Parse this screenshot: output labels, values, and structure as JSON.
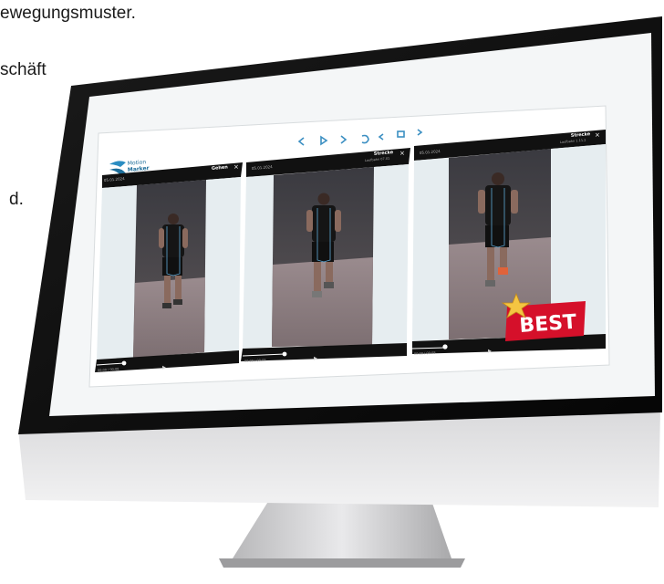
{
  "page": {
    "text_lines": [
      "ewegungsmuster.",
      "schäft",
      "d."
    ]
  },
  "app": {
    "logo_line1": "Motion",
    "logo_line2": "Marker",
    "toolbar_icons": [
      "chevron-left-icon",
      "play-icon",
      "chevron-right-icon",
      "undo-icon",
      "share-icon",
      "export-icon",
      "next-icon"
    ]
  },
  "panels": [
    {
      "header_title": "Gehen",
      "date": "05.01.2024",
      "time_label": "00:00 / 00:08"
    },
    {
      "header_title": "Strecke",
      "date": "05.01.2024",
      "subtitle": "Laufbahn 07.01",
      "time_label": "00:00 / 00:08"
    },
    {
      "header_title": "Strecke",
      "date": "05.01.2024",
      "subtitle": "Laufbahn 1.11.2",
      "time_label": "00:00 / 00:08"
    }
  ],
  "badge": {
    "label": "BEST"
  },
  "progress": [
    0.28,
    0.45,
    0.3
  ],
  "colors": {
    "screen_bg": "#f4f6f7",
    "bezel": "#0d0d0d",
    "badge_red": "#d5102a",
    "star": "#f4c542",
    "accent": "#3b8fc2"
  }
}
